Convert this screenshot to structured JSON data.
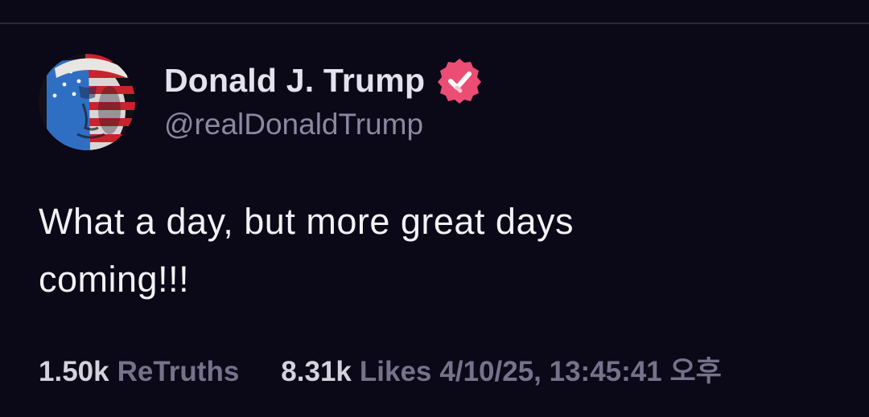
{
  "author": {
    "display_name": "Donald J. Trump",
    "handle": "@realDonaldTrump",
    "verified": true,
    "verified_color": "#ec4d74"
  },
  "post": {
    "text_line1": "What a day, but more great days",
    "text_line2": "coming!!!"
  },
  "stats": {
    "retruths_count": "1.50k",
    "retruths_label": "ReTruths",
    "likes_count": "8.31k",
    "likes_label": "Likes",
    "timestamp": "4/10/25, 13:45:41 오후"
  },
  "colors": {
    "background": "#0b0817",
    "divider": "#2a2740",
    "name": "#e4e2ee",
    "muted": "#75728a",
    "body_text": "#f2f1f7"
  }
}
